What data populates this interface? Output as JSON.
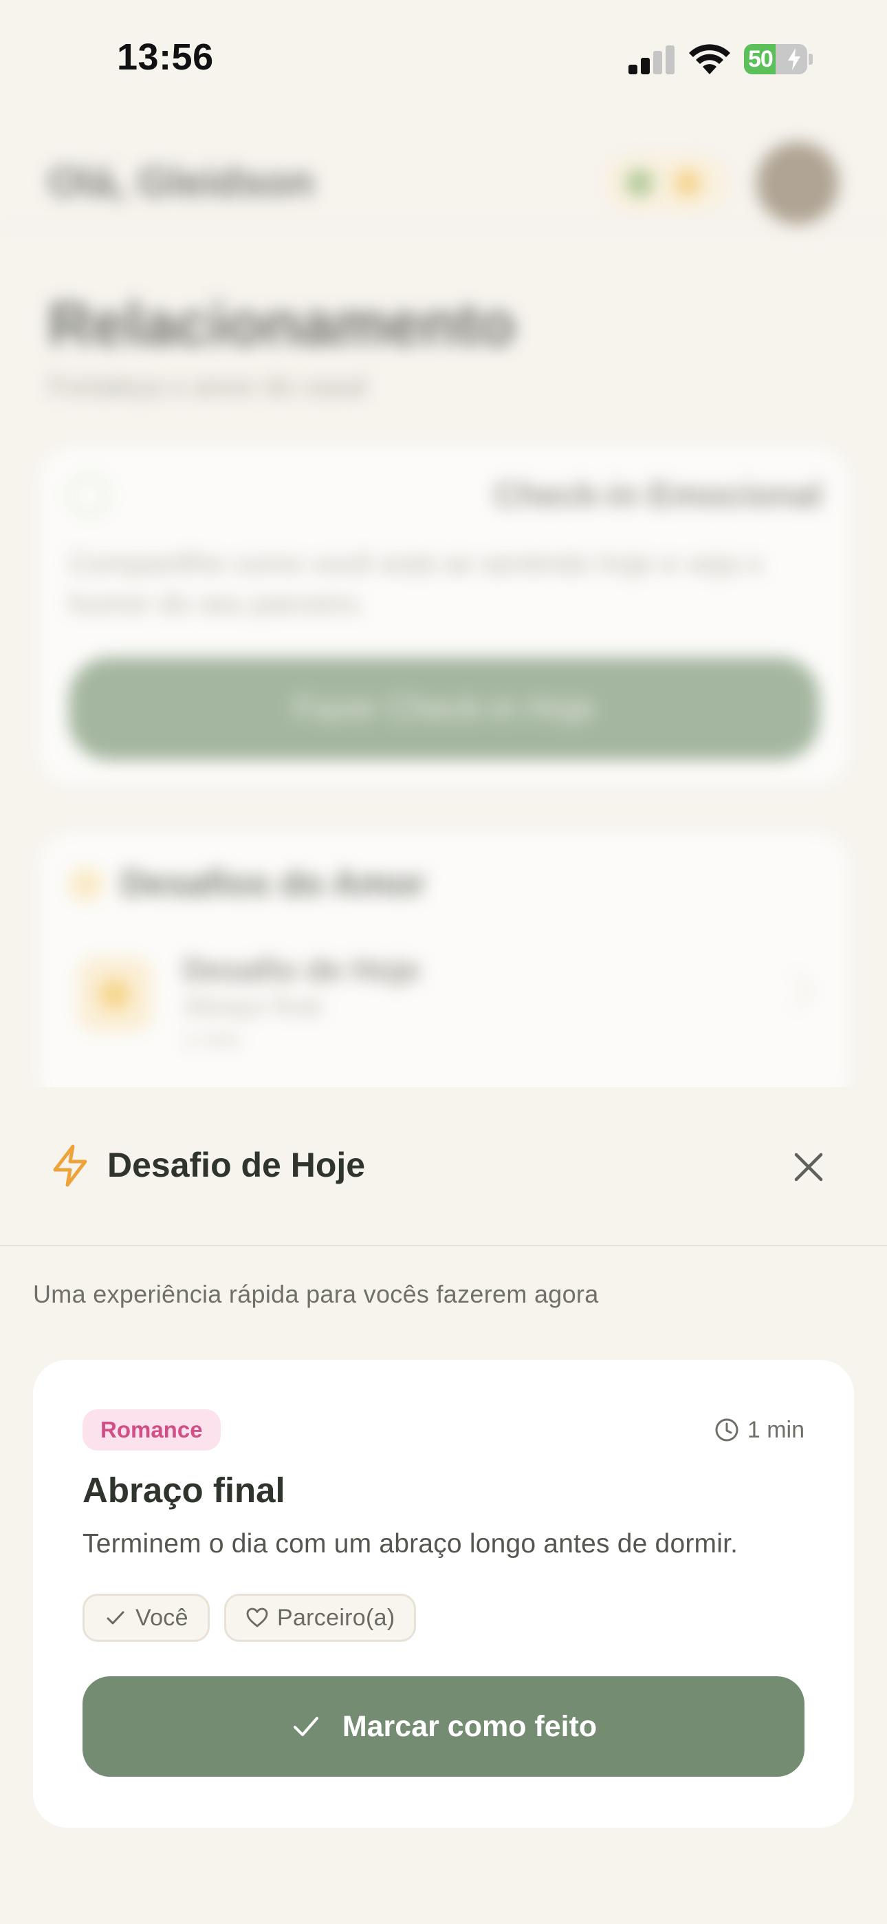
{
  "status_bar": {
    "time": "13:56",
    "battery_level": 50,
    "battery_label": "50",
    "icons": [
      "cellular-signal-icon",
      "wifi-icon",
      "battery-charging-icon"
    ]
  },
  "background_screen": {
    "greeting": "Olá, Gleidson",
    "page_title": "Relacionamento",
    "page_subtitle": "Fortaleça o amor do casal",
    "checkin_card": {
      "tag": "Check-in Emocional",
      "text": "Compartilhe como você está se sentindo hoje e veja o humor do seu parceiro.",
      "button_label": "Fazer Check-in Hoje"
    },
    "challenges_card": {
      "title": "Desafios do Amor",
      "item_title": "Desafio de Hoje",
      "item_line1": "Abraço final",
      "item_line2": "1 min"
    }
  },
  "sheet": {
    "title": "Desafio de Hoje",
    "description": "Uma experiência rápida para vocês fazerem agora",
    "challenge": {
      "category": "Romance",
      "duration": "1 min",
      "title": "Abraço final",
      "text": "Terminem o dia com um abraço longo antes de dormir.",
      "participants": [
        {
          "label": "Você",
          "icon": "check-icon",
          "done": true
        },
        {
          "label": "Parceiro(a)",
          "icon": "heart-outline-icon",
          "done": false
        }
      ],
      "button_label": "Marcar como feito"
    }
  },
  "colors": {
    "background": "#f7f4ee",
    "primary_green": "#748c72",
    "romance_badge_bg": "#fbe2ec",
    "romance_badge_text": "#d14f86",
    "bolt_orange": "#eda23a"
  }
}
